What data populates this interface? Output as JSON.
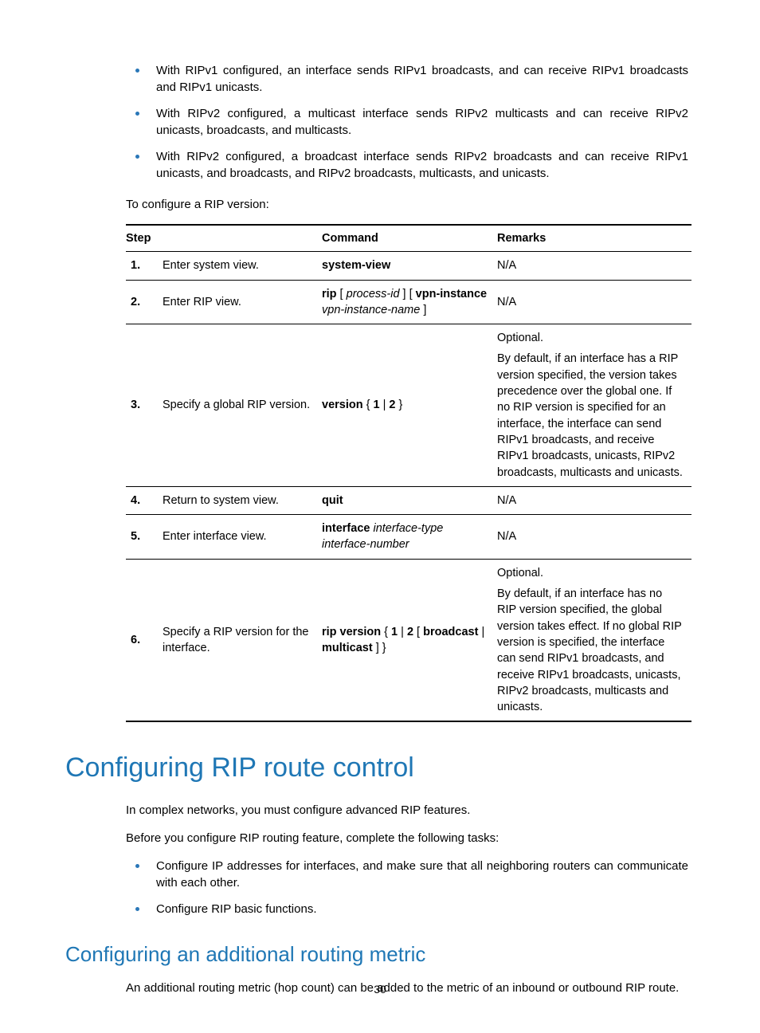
{
  "bullets_top": [
    "With RIPv1 configured, an interface sends RIPv1 broadcasts, and can receive RIPv1 broadcasts and RIPv1 unicasts.",
    "With RIPv2 configured, a multicast interface sends RIPv2 multicasts and can receive RIPv2 unicasts, broadcasts, and multicasts.",
    "With RIPv2 configured, a broadcast interface sends RIPv2 broadcasts and can receive RIPv1 unicasts, and broadcasts, and RIPv2 broadcasts, multicasts, and unicasts."
  ],
  "lead_text": "To configure a RIP version:",
  "table": {
    "headers": {
      "step": "Step",
      "command": "Command",
      "remarks": "Remarks"
    },
    "rows": [
      {
        "num": "1.",
        "step": "Enter system view.",
        "cmd": [
          {
            "b": "system-view"
          }
        ],
        "remarks": [
          "N/A"
        ]
      },
      {
        "num": "2.",
        "step": "Enter RIP view.",
        "cmd": [
          {
            "b": "rip"
          },
          {
            "t": " [ "
          },
          {
            "i": "process-id"
          },
          {
            "t": " ] [ "
          },
          {
            "b": "vpn-instance"
          },
          {
            "t": " "
          },
          {
            "i": "vpn-instance-name"
          },
          {
            "t": " ]"
          }
        ],
        "remarks": [
          "N/A"
        ]
      },
      {
        "num": "3.",
        "step": "Specify a global RIP version.",
        "cmd": [
          {
            "b": "version"
          },
          {
            "t": " { "
          },
          {
            "b": "1"
          },
          {
            "t": " | "
          },
          {
            "b": "2"
          },
          {
            "t": " }"
          }
        ],
        "remarks": [
          "Optional.",
          "By default, if an interface has a RIP version specified, the version takes precedence over the global one. If no RIP version is specified for an interface, the interface can send RIPv1 broadcasts, and receive RIPv1 broadcasts, unicasts, RIPv2 broadcasts, multicasts and unicasts."
        ]
      },
      {
        "num": "4.",
        "step": "Return to system view.",
        "cmd": [
          {
            "b": "quit"
          }
        ],
        "remarks": [
          "N/A"
        ]
      },
      {
        "num": "5.",
        "step": "Enter interface view.",
        "cmd": [
          {
            "b": "interface"
          },
          {
            "t": " "
          },
          {
            "i": "interface-type interface-number"
          }
        ],
        "remarks": [
          "N/A"
        ]
      },
      {
        "num": "6.",
        "step": "Specify a RIP version for the interface.",
        "cmd": [
          {
            "b": "rip version"
          },
          {
            "t": " { "
          },
          {
            "b": "1"
          },
          {
            "t": " | "
          },
          {
            "b": "2"
          },
          {
            "t": " [ "
          },
          {
            "b": "broadcast"
          },
          {
            "t": " | "
          },
          {
            "b": "multicast"
          },
          {
            "t": " ] }"
          }
        ],
        "remarks": [
          "Optional.",
          "By default, if an interface has no RIP version specified, the global version takes effect. If no global RIP version is specified, the interface can send RIPv1 broadcasts, and receive RIPv1 broadcasts, unicasts, RIPv2 broadcasts, multicasts and unicasts."
        ]
      }
    ]
  },
  "h1": "Configuring RIP route control",
  "para1": "In complex networks, you must configure advanced RIP features.",
  "para2": "Before you configure RIP routing feature, complete the following tasks:",
  "bullets_mid": [
    "Configure IP addresses for interfaces, and make sure that all neighboring routers can communicate with each other.",
    "Configure RIP basic functions."
  ],
  "h2": "Configuring an additional routing metric",
  "para3": "An additional routing metric (hop count) can be added to the metric of an inbound or outbound RIP route.",
  "pagenum": "30"
}
